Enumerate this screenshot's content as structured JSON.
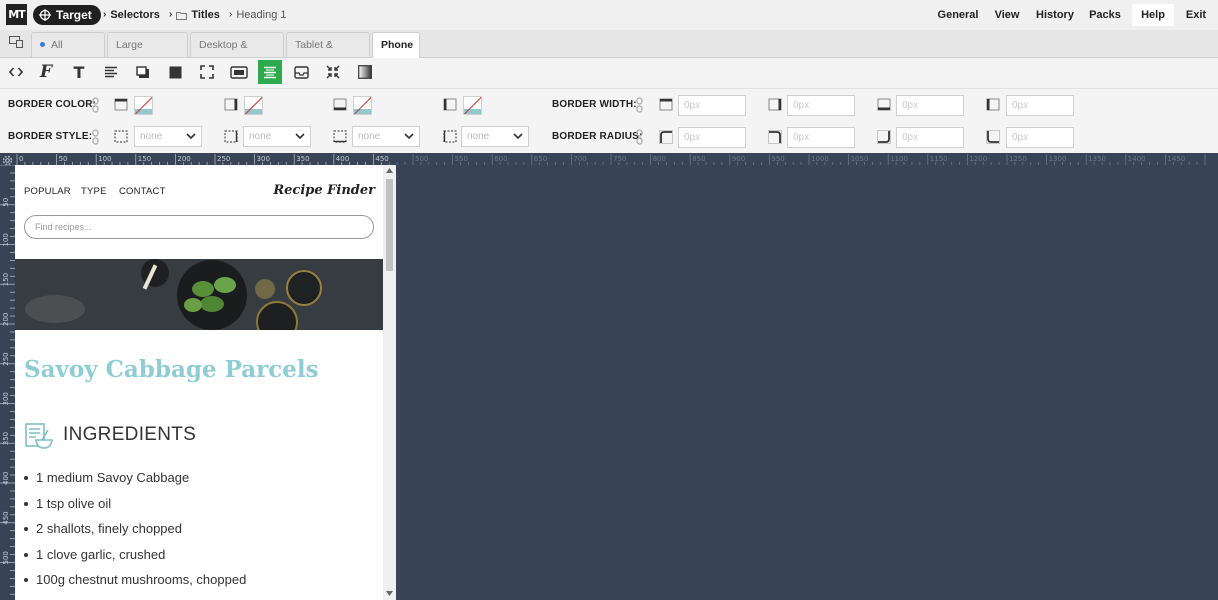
{
  "app": {
    "logo_text": "MT",
    "target_label": "Target",
    "breadcrumb": [
      {
        "label": "Selectors"
      },
      {
        "label": "Titles"
      },
      {
        "label": "Heading 1"
      }
    ],
    "nav": [
      "General",
      "View",
      "History",
      "Packs",
      "Help",
      "Exit"
    ],
    "nav_active": "Help"
  },
  "tabs": {
    "items": [
      "All Devices",
      "Large Desktop",
      "Desktop & Tablet",
      "Tablet & Phone",
      "Phone"
    ],
    "active": "Phone"
  },
  "toolbar": {
    "icons": [
      "code-icon",
      "font-icon",
      "text-icon",
      "align-icon",
      "shadow-icon",
      "background-icon",
      "expand-icon",
      "spacing-icon",
      "border-icon",
      "inbox-icon",
      "compress-icon",
      "gradient-icon"
    ],
    "active": "border-icon"
  },
  "properties": {
    "border_color_label": "BORDER COLOR:",
    "border_style_label": "BORDER STYLE:",
    "border_width_label": "BORDER WIDTH:",
    "border_radius_label": "BORDER RADIUS:",
    "width_placeholder": "0px",
    "radius_placeholder": "0px",
    "style_value": "none",
    "swatch_color": "#93c9cc"
  },
  "ruler": {
    "h_marks": [
      "0",
      "50",
      "100",
      "150",
      "200",
      "250",
      "300",
      "350",
      "400",
      "450",
      "500",
      "550",
      "600",
      "650",
      "700",
      "750",
      "800",
      "850",
      "900",
      "950",
      "1000",
      "1050",
      "1100",
      "1150",
      "1200",
      "1250",
      "1300",
      "1350",
      "1400",
      "1450"
    ],
    "v_marks": [
      "50",
      "100",
      "150",
      "200",
      "250",
      "300",
      "350",
      "400",
      "450",
      "500"
    ]
  },
  "page": {
    "nav_links": [
      "POPULAR",
      "TYPE",
      "CONTACT"
    ],
    "brand": "Recipe Finder",
    "search_placeholder": "Find recipes...",
    "title": "Savoy Cabbage Parcels",
    "ingredients_heading": "INGREDIENTS",
    "ingredients": [
      "1 medium Savoy Cabbage",
      "1 tsp olive oil",
      "2 shallots, finely chopped",
      "1 clove garlic, crushed",
      "100g chestnut mushrooms, chopped"
    ],
    "title_color": "#8ecdd3"
  },
  "colors": {
    "workspace_bg": "#3a4457",
    "active_tool": "#2eaa4d",
    "accent_dot": "#3d7be0"
  }
}
